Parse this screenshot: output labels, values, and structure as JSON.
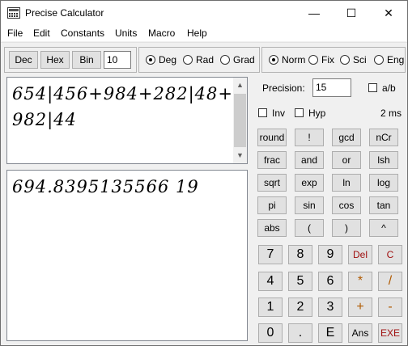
{
  "window": {
    "title": "Precise Calculator",
    "controls": [
      "—",
      "☐",
      "✕"
    ]
  },
  "menu": [
    "File",
    "Edit",
    "Constants",
    "Units",
    "Macro",
    "Help"
  ],
  "base": {
    "buttons": [
      "Dec",
      "Hex",
      "Bin"
    ],
    "value": "10"
  },
  "angle": {
    "options": [
      "Deg",
      "Rad",
      "Grad"
    ],
    "selected": "Deg"
  },
  "notation": {
    "options": [
      "Norm",
      "Fix",
      "Sci",
      "Eng"
    ],
    "selected": "Norm"
  },
  "precision": {
    "label": "Precision:",
    "value": "15",
    "ab_label": "a/b"
  },
  "flags": {
    "inv": "Inv",
    "hyp": "Hyp",
    "time": "2 ms"
  },
  "expression": {
    "lines": [
      "654|456+984+282|48+",
      "982|44"
    ]
  },
  "result": {
    "value": "694.8395135566 19"
  },
  "functions": [
    [
      "round",
      "!",
      "gcd",
      "nCr"
    ],
    [
      "frac",
      "and",
      "or",
      "lsh"
    ],
    [
      "sqrt",
      "exp",
      "ln",
      "log"
    ],
    [
      "pi",
      "sin",
      "cos",
      "tan"
    ],
    [
      "abs",
      "(",
      ")",
      "^"
    ]
  ],
  "keypad": [
    [
      "7",
      "8",
      "9",
      "Del",
      "C"
    ],
    [
      "4",
      "5",
      "6",
      "*",
      "/"
    ],
    [
      "1",
      "2",
      "3",
      "+",
      "-"
    ],
    [
      "0",
      ".",
      "E",
      "Ans",
      "EXE"
    ]
  ],
  "colors": {
    "accent_red": "#a01010",
    "accent_orange": "#b05a00"
  }
}
